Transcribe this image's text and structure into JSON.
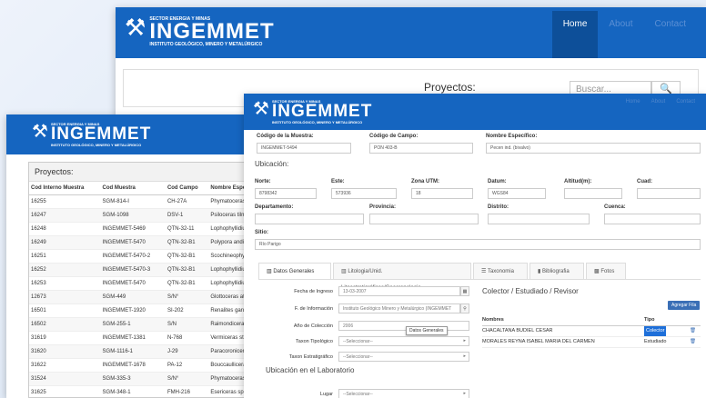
{
  "window_back": {
    "logo": {
      "top": "SECTOR ENERGIA Y MINAS",
      "brand": "INGEMMET",
      "sub": "INSTITUTO GEOLÓGICO, MINERO Y METALÚRGICO"
    },
    "nav": {
      "home": "Home",
      "about": "About",
      "contact": "Contact"
    },
    "projects_title": "Proyectos:",
    "search_placeholder": "Buscar..."
  },
  "window_left": {
    "logo": {
      "top": "SECTOR ENERGIA Y MINAS",
      "brand": "INGEMMET",
      "sub": "INSTITUTO GEOLÓGICO, MINERO Y METALÚRGICO"
    },
    "panel_title": "Proyectos:",
    "columns": [
      "Cod Interno Muestra",
      "Cod Muestra",
      "Cod Campo",
      "Nombre Especi"
    ],
    "rows": [
      [
        "16255",
        "SGM-814-I",
        "CH-27A",
        "Phymatoceras c"
      ],
      [
        "16247",
        "SGM-1098",
        "DSV-1",
        "Psiloceras tilma"
      ],
      [
        "16248",
        "INGEMMET-5469",
        "QTN-32-11",
        "Lophophyllidium"
      ],
      [
        "16249",
        "INGEMMET-5470",
        "QTN-32-B1",
        "Polypora andina"
      ],
      [
        "16251",
        "INGEMMET-5470-2",
        "QTN-32-B1",
        "Scochineophyll"
      ],
      [
        "16252",
        "INGEMMET-5470-3",
        "QTN-32-B1",
        "Lophophyllidium"
      ],
      [
        "16253",
        "INGEMMET-5470",
        "QTN-32-B1",
        "Lophophyllidium"
      ],
      [
        "12673",
        "SGM-449",
        "S/N°",
        "Glottoceras atte"
      ],
      [
        "16501",
        "INGEMMET-1920",
        "SI-202",
        "Renalites gardne"
      ],
      [
        "16502",
        "SGM-255-1",
        "S/N",
        "Raimondiceras c"
      ],
      [
        "31619",
        "INGEMMET-1381",
        "N-768",
        "Vermiceras stut"
      ],
      [
        "31620",
        "SGM-1116-1",
        "J-29",
        "Paracoroniceras"
      ],
      [
        "31622",
        "INGEMMET-1678",
        "PA-12",
        "Bouccaulliceras r"
      ],
      [
        "31524",
        "SGM-335-3",
        "S/N°",
        "Phymatoceras a"
      ],
      [
        "31625",
        "SGM-348-1",
        "FMH-216",
        "Esericeras sp."
      ]
    ]
  },
  "window_front": {
    "logo": {
      "top": "SECTOR ENERGIA Y MINAS",
      "brand": "INGEMMET",
      "sub": "INSTITUTO GEOLÓGICO, MINERO Y METALÚRGICO"
    },
    "nav": {
      "home": "Home",
      "about": "About",
      "contact": "Contact"
    },
    "codigo_muestra": {
      "label": "Código de la Muestra:",
      "value": "INGEMMET-5494"
    },
    "codigo_campo": {
      "label": "Código de Campo:",
      "value": "PON 403-B"
    },
    "nombre_especifico": {
      "label": "Nombre Específico:",
      "value": "Pecen ind. (bivalvo)"
    },
    "ubicacion_title": "Ubicación:",
    "norte": {
      "label": "Norte:",
      "value": "8798342"
    },
    "este": {
      "label": "Este:",
      "value": "573936"
    },
    "zona": {
      "label": "Zona UTM:",
      "value": "18"
    },
    "datum": {
      "label": "Datum:",
      "value": "WGS84"
    },
    "altitud": {
      "label": "Altitud(m):",
      "value": ""
    },
    "cuad": {
      "label": "Cuad:",
      "value": ""
    },
    "departamento": {
      "label": "Departamento:",
      "value": ""
    },
    "provincia": {
      "label": "Provincia:",
      "value": ""
    },
    "distrito": {
      "label": "Distrito:",
      "value": ""
    },
    "cuenca": {
      "label": "Cuenca:",
      "value": ""
    },
    "sitio": {
      "label": "Sitio:",
      "value": "Río Parigo"
    },
    "tabs": [
      "Datos Generales",
      "Litologia/Unid. Litoestratigráficas/Geocronologia",
      "Taxonomia",
      "Bibliografia",
      "Fotos"
    ],
    "fecha_ingreso": {
      "label": "Fecha de Ingreso",
      "value": "13-03-2007"
    },
    "f_informacion": {
      "label": "F. de Información",
      "value": "Instituto Geológico Minero y Metalúrgico (INGEMMET"
    },
    "anio_coleccion": {
      "label": "Año de Colección",
      "value": "2006"
    },
    "taxon_tipologico": {
      "label": "Taxon Tipológico",
      "value": "--Seleccionar--"
    },
    "taxon_estratigrafico": {
      "label": "Taxon Estratigráfico",
      "value": "--Seleccionar--"
    },
    "tooltip": "Datos Generales",
    "ubicacion_lab_title": "Ubicación en el Laboratorio",
    "lugar": {
      "label": "Lugar",
      "value": "--Seleccionar--"
    },
    "colector_title": "Colector / Estudiado / Revisor",
    "agregar_fila": "Agregar Fila",
    "col_headers": [
      "Nombres",
      "Tipo"
    ],
    "colectores": [
      {
        "nombre": "CHACALTANA BUDIEL CESAR",
        "tipo": "Colector"
      },
      {
        "nombre": "MORALES REYNA ISABEL MARIA DEL CARMEN",
        "tipo": "Estudiado"
      }
    ]
  }
}
